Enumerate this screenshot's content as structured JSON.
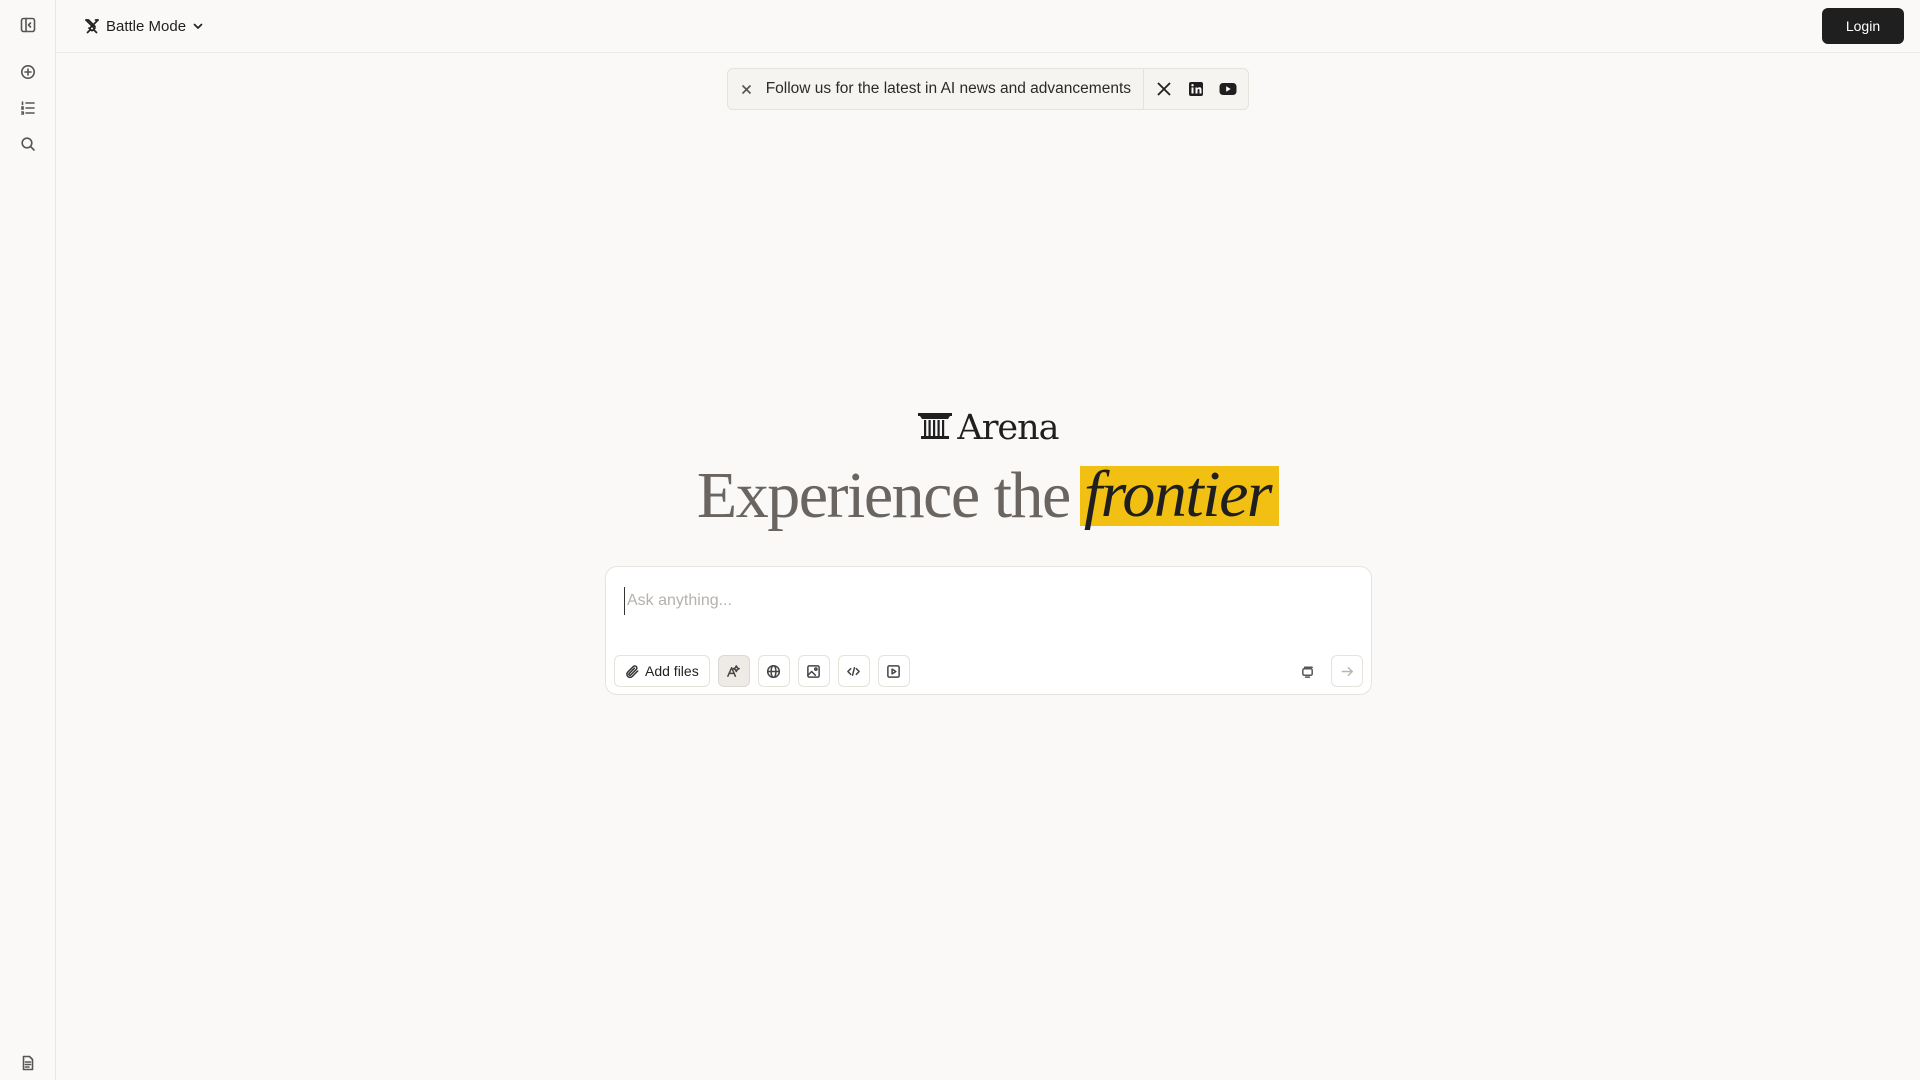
{
  "sidebar": {
    "items": [
      {
        "icon": "sidebar-toggle-icon"
      },
      {
        "icon": "new-chat-icon"
      },
      {
        "icon": "leaderboard-icon"
      },
      {
        "icon": "search-icon"
      }
    ],
    "footer_icon": "document-icon"
  },
  "header": {
    "mode_label": "Battle Mode",
    "login_label": "Login"
  },
  "banner": {
    "text": "Follow us for the latest in AI news and advancements",
    "socials": [
      "x-icon",
      "linkedin-icon",
      "youtube-icon"
    ]
  },
  "hero": {
    "logo_text": "Arena",
    "headline_prefix": "Experience the",
    "headline_highlight": "frontier"
  },
  "composer": {
    "placeholder": "Ask anything...",
    "add_files_label": "Add files",
    "tools": [
      "auto-mode-icon",
      "web-search-icon",
      "image-icon",
      "code-icon",
      "video-icon"
    ]
  },
  "colors": {
    "background": "#faf9f7",
    "highlight": "#f2c012",
    "login_bg": "#1f1f1f"
  }
}
